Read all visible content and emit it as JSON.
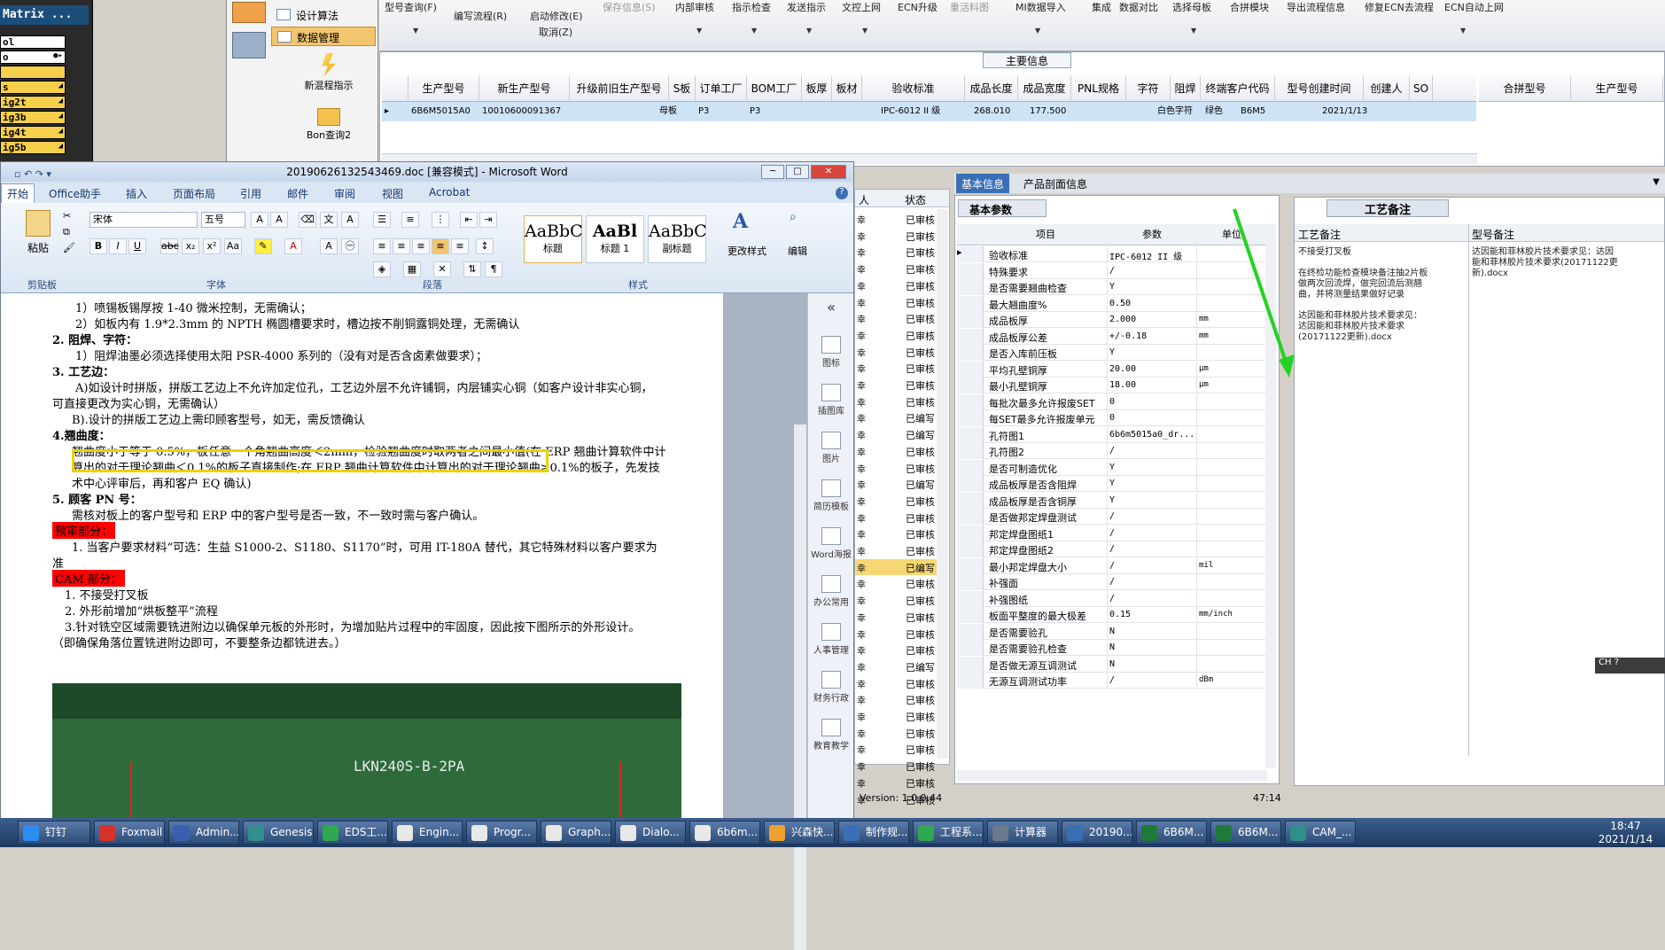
{
  "left_list": {
    "title": "Matrix ...",
    "items": [
      "ol",
      "o",
      "",
      "s",
      "ig2t",
      "ig3b",
      "ig4t",
      "ig5b"
    ]
  },
  "erp_menu": {
    "items": [
      "设计算法",
      "数据管理"
    ],
    "big_buttons": [
      "新混程指示",
      "Bon查询2"
    ]
  },
  "erp_toolbar": {
    "buttons": [
      {
        "label": "型号查询(F)"
      },
      {
        "label": "编写流程(R)"
      },
      {
        "label": "启动修改(E)"
      },
      {
        "label": "取消(Z)"
      },
      {
        "label": "保存信息(S)"
      },
      {
        "label": "内部审核"
      },
      {
        "label": "指示检查"
      },
      {
        "label": "发送指示"
      },
      {
        "label": "文控上网"
      },
      {
        "label": "ECN升级"
      },
      {
        "label": "重活料图"
      },
      {
        "label": "MI数据导入"
      },
      {
        "label": "集成"
      },
      {
        "label": "数据对比"
      },
      {
        "label": "选择母板"
      },
      {
        "label": "合拼模块"
      },
      {
        "label": "导出流程信息"
      },
      {
        "label": "修复ECN去流程"
      },
      {
        "label": "ECN自动上网"
      }
    ]
  },
  "main_info": {
    "title": "主要信息",
    "columns": [
      "生产型号",
      "新生产型号",
      "升级前旧生产型号",
      "S板",
      "订单工厂",
      "BOM工厂",
      "板厚",
      "板材",
      "验收标准",
      "成品长度",
      "成品宽度",
      "PNL规格",
      "字符",
      "阻焊",
      "终端客户代码",
      "型号创建时间",
      "创建人",
      "SO"
    ],
    "row": [
      "6B6M5015A0",
      "10010600091367",
      "",
      "母板",
      "P3",
      "P3",
      "",
      "",
      "IPC-6012 II 级",
      "268.010",
      "177.500",
      "",
      "白色字符",
      "绿色",
      "B6M5",
      "2021/1/13",
      "",
      ""
    ],
    "right_columns": [
      "合拼型号",
      "生产型号"
    ]
  },
  "word": {
    "title": "20190626132543469.doc [兼容模式] - Microsoft Word",
    "tabs": [
      "开始",
      "Office助手",
      "插入",
      "页面布局",
      "引用",
      "邮件",
      "审阅",
      "视图",
      "Acrobat"
    ],
    "font_name": "宋体",
    "font_size": "五号",
    "groups": [
      "剪贴板",
      "字体",
      "段落",
      "样式",
      "编辑"
    ],
    "paste": "粘贴",
    "styles": [
      {
        "sample": "AaBbC",
        "name": "标题"
      },
      {
        "sample": "AaBl",
        "name": "标题 1"
      },
      {
        "sample": "AaBbC",
        "name": "副标题"
      }
    ],
    "change_style": "更改样式",
    "edit": "编辑",
    "lines": [
      "1）喷锡板锡厚按 1-40 微米控制，无需确认；",
      "2）如板内有 1.9*2.3mm 的 NPTH 椭圆槽要求时，槽边按不削铜露铜处理，无需确认",
      "2.   阻焊、字符：",
      "1）阻焊油墨必须选择使用太阳 PSR-4000 系列的（没有对是否含卤素做要求）；",
      "3.  工艺边：",
      "A)如设计时拼版，拼版工艺边上不允许加定位孔，工艺边外层不允许铺铜，内层铺实心铜（如客户设计非实心铜，",
      "可直接更改为实心铜，无需确认）",
      "B).设计的拼版工艺边上需印顾客型号，如无，需反馈确认",
      "4.翘曲度：",
      "翘曲度小于等于 0.5%，板任意一个角翘曲高度＜2mm，检验翘曲度时取两者之间最小值(在 ERP 翘曲计算软件中计",
      "算出的对于理论翘曲＜0.1%的板子直接制作;在 ERP 翘曲计算软件中计算出的对于理论翘曲≥0.1%的板子，先发技",
      "术中心评审后，再和客户 EQ 确认)",
      "5.  顾客 PN 号：",
      "需核对板上的客户型号和 ERP 中的客户型号是否一致，不一致时需与客户确认。",
      "预审部分：",
      "1. 当客户要求材料“可选：生益 S1000-2、S1180、S1170”时，可用 IT-180A 替代，其它特殊材料以客户要求为",
      "准",
      "CAM 部分：",
      "1.  不接受打叉板",
      "2.  外形前增加“烘板整平”流程",
      "3.针对铣空区域需要铣进附边以确保单元板的外形时，为增加贴片过程中的牢固度，因此按下图所示的外形设计。",
      "（即确保角落位置铣进附边即可，不要整条边都铣进去。）"
    ],
    "photo_label": "LKN240S-B-2PA",
    "side_tools": [
      "图标",
      "插图库",
      "图片",
      "简历模板",
      "Word海报",
      "办公常用",
      "人事管理",
      "财务行政",
      "教育教学"
    ]
  },
  "mid_col": {
    "header_a": "人",
    "header_b": "状态",
    "status_values": [
      "已审核",
      "已审核",
      "已审核",
      "已审核",
      "已审核",
      "已审核",
      "已审核",
      "已审核",
      "已审核",
      "已审核",
      "已审核",
      "已审核",
      "已编写",
      "已编写",
      "已审核",
      "已审核",
      "已编写",
      "已审核",
      "已审核",
      "已审核",
      "已审核",
      "已编写",
      "已审核",
      "已审核",
      "已审核",
      "已审核",
      "已审核",
      "已编写",
      "已审核",
      "已审核",
      "已审核",
      "已审核",
      "已审核",
      "已审核",
      "已审核",
      "已审核"
    ],
    "names": [
      "幸",
      "幸",
      "幸",
      "幸",
      "幸",
      "幸",
      "幸",
      "幸",
      "幸",
      "幸",
      "幸",
      "幸",
      "幸",
      "幸",
      "幸",
      "幸",
      "幸",
      "幸",
      "幸",
      "幸",
      "幸",
      "幸",
      "幸",
      "幸",
      "幸",
      "幸",
      "幸",
      "幸",
      "幸",
      "幸",
      "幸",
      "幸",
      "幸",
      "幸",
      "幸",
      "幸"
    ]
  },
  "right_tabs": [
    "基本信息",
    "产品剖面信息"
  ],
  "basic": {
    "title": "基本参数",
    "columns": [
      "项目",
      "参数",
      "单位"
    ],
    "rows": [
      [
        "验收标准",
        "IPC-6012 II 级",
        ""
      ],
      [
        "特殊要求",
        "/",
        ""
      ],
      [
        "是否需要翘曲检查",
        "Y",
        ""
      ],
      [
        "最大翘曲度%",
        "0.50",
        ""
      ],
      [
        "成品板厚",
        "2.000",
        "mm"
      ],
      [
        "成品板厚公差",
        "+/-0.18",
        "mm"
      ],
      [
        "是否入库前压板",
        "Y",
        ""
      ],
      [
        "平均孔壁铜厚",
        "20.00",
        "μm"
      ],
      [
        "最小孔壁铜厚",
        "18.00",
        "μm"
      ],
      [
        "每批次最多允许报废SET",
        "0",
        ""
      ],
      [
        "每SET最多允许报废单元",
        "0",
        ""
      ],
      [
        "孔符图1",
        "6b6m5015a0_dr...",
        ""
      ],
      [
        "孔符图2",
        "/",
        ""
      ],
      [
        "是否可制造优化",
        "Y",
        ""
      ],
      [
        "成品板厚是否含阻焊",
        "Y",
        ""
      ],
      [
        "成品板厚是否含铜厚",
        "Y",
        ""
      ],
      [
        "是否做邦定焊盘测试",
        "/",
        ""
      ],
      [
        "邦定焊盘图纸1",
        "/",
        ""
      ],
      [
        "邦定焊盘图纸2",
        "/",
        ""
      ],
      [
        "最小邦定焊盘大小",
        "/",
        "mil"
      ],
      [
        "补强面",
        "/",
        ""
      ],
      [
        "补强图纸",
        "/",
        ""
      ],
      [
        "板面平整度的最大极差",
        "0.15",
        "mm/inch"
      ],
      [
        "是否需要验孔",
        "N",
        ""
      ],
      [
        "是否需要验孔检查",
        "N",
        ""
      ],
      [
        "是否做无源互调测试",
        "N",
        ""
      ],
      [
        "无源互调测试功率",
        "/",
        "dBm"
      ]
    ]
  },
  "process": {
    "title": "工艺备注",
    "col_a": "工艺备注",
    "col_b": "型号备注",
    "note_a": [
      "不接受打叉板",
      "",
      "在终检功能检查模块备注抽2片板",
      "做两次回流焊，做完回流后测翘",
      "曲，并将测量结果做好记录",
      "",
      "达因能和菲林胶片技术要求见：",
      "达因能和菲林胶片技术要求",
      "(20171122更新).docx"
    ],
    "note_b": [
      "达因能和菲林胶片技术要求见：达因",
      "能和菲林胶片技术要求(20171122更",
      "新).docx"
    ]
  },
  "version": "Version: 1.0.0.44",
  "status_time": "47:14",
  "ime": "CH",
  "taskbar": {
    "items": [
      {
        "label": "钉钉",
        "color": "#2d8cf0"
      },
      {
        "label": "Foxmail",
        "color": "#d6322b"
      },
      {
        "label": "Admin...",
        "color": "#3a5fb0"
      },
      {
        "label": "Genesis",
        "color": "#2f8f8a"
      },
      {
        "label": "EDS工...",
        "color": "#2fa84f"
      },
      {
        "label": "Engin...",
        "color": "#e8e8e8"
      },
      {
        "label": "Progr...",
        "color": "#e8e8e8"
      },
      {
        "label": "Graph...",
        "color": "#e8e8e8"
      },
      {
        "label": "Dialo...",
        "color": "#e8e8e8"
      },
      {
        "label": "6b6m...",
        "color": "#e8e8e8"
      },
      {
        "label": "兴森快...",
        "color": "#f0a030"
      },
      {
        "label": "制作规...",
        "color": "#3a6fb5"
      },
      {
        "label": "工程系...",
        "color": "#2fa84f"
      },
      {
        "label": "计算器",
        "color": "#6a7a8a"
      },
      {
        "label": "20190...",
        "color": "#3a6fb5"
      },
      {
        "label": "6B6M...",
        "color": "#1f7a3a"
      },
      {
        "label": "6B6M...",
        "color": "#1f7a3a"
      },
      {
        "label": "CAM_...",
        "color": "#2f8f8a"
      }
    ],
    "time": "18:47",
    "date": "2021/1/14"
  },
  "accent": "#3a6fb5",
  "highlight_color": "#e8d400",
  "arrow_color": "#22d322"
}
